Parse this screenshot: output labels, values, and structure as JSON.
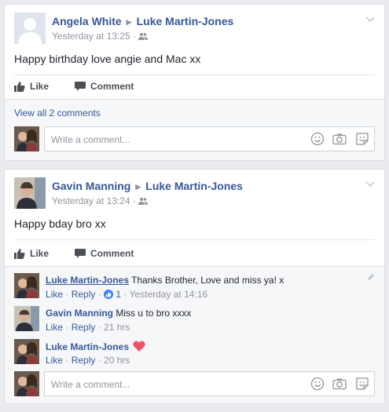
{
  "posts": [
    {
      "author": "Angela White",
      "target": "Luke Martin-Jones",
      "time": "Yesterday at 13:25",
      "text": "Happy birthday love angie and Mac xx",
      "like_label": "Like",
      "comment_label": "Comment",
      "view_comments": "View all 2 comments",
      "write_placeholder": "Write a comment..."
    },
    {
      "author": "Gavin Manning",
      "target": "Luke Martin-Jones",
      "time": "Yesterday at 13:24",
      "text": "Happy bday bro xx",
      "like_label": "Like",
      "comment_label": "Comment",
      "comments": [
        {
          "author": "Luke Martin-Jones",
          "text": "Thanks Brother, Love and miss ya! x",
          "like": "Like",
          "reply": "Reply",
          "reactions": "1",
          "time": "Yesterday at 14:16"
        },
        {
          "author": "Gavin Manning",
          "text": "Miss u to bro xxxx",
          "like": "Like",
          "reply": "Reply",
          "time": "21 hrs"
        },
        {
          "author": "Luke Martin-Jones",
          "text": "",
          "like": "Like",
          "reply": "Reply",
          "time": "20 hrs"
        }
      ],
      "write_placeholder": "Write a comment..."
    }
  ],
  "colors": {
    "link": "#365899",
    "muted": "#90949c",
    "background": "#e9ebee",
    "heart": "#f25268",
    "reaction_blue": "#4080ff"
  },
  "icons": [
    "default-avatar-icon",
    "friends-audience-icon",
    "chevron-down-icon",
    "like-thumb-icon",
    "comment-bubble-icon",
    "emoji-icon",
    "camera-icon",
    "sticker-icon",
    "heart-icon",
    "like-reaction-icon",
    "pencil-icon"
  ]
}
